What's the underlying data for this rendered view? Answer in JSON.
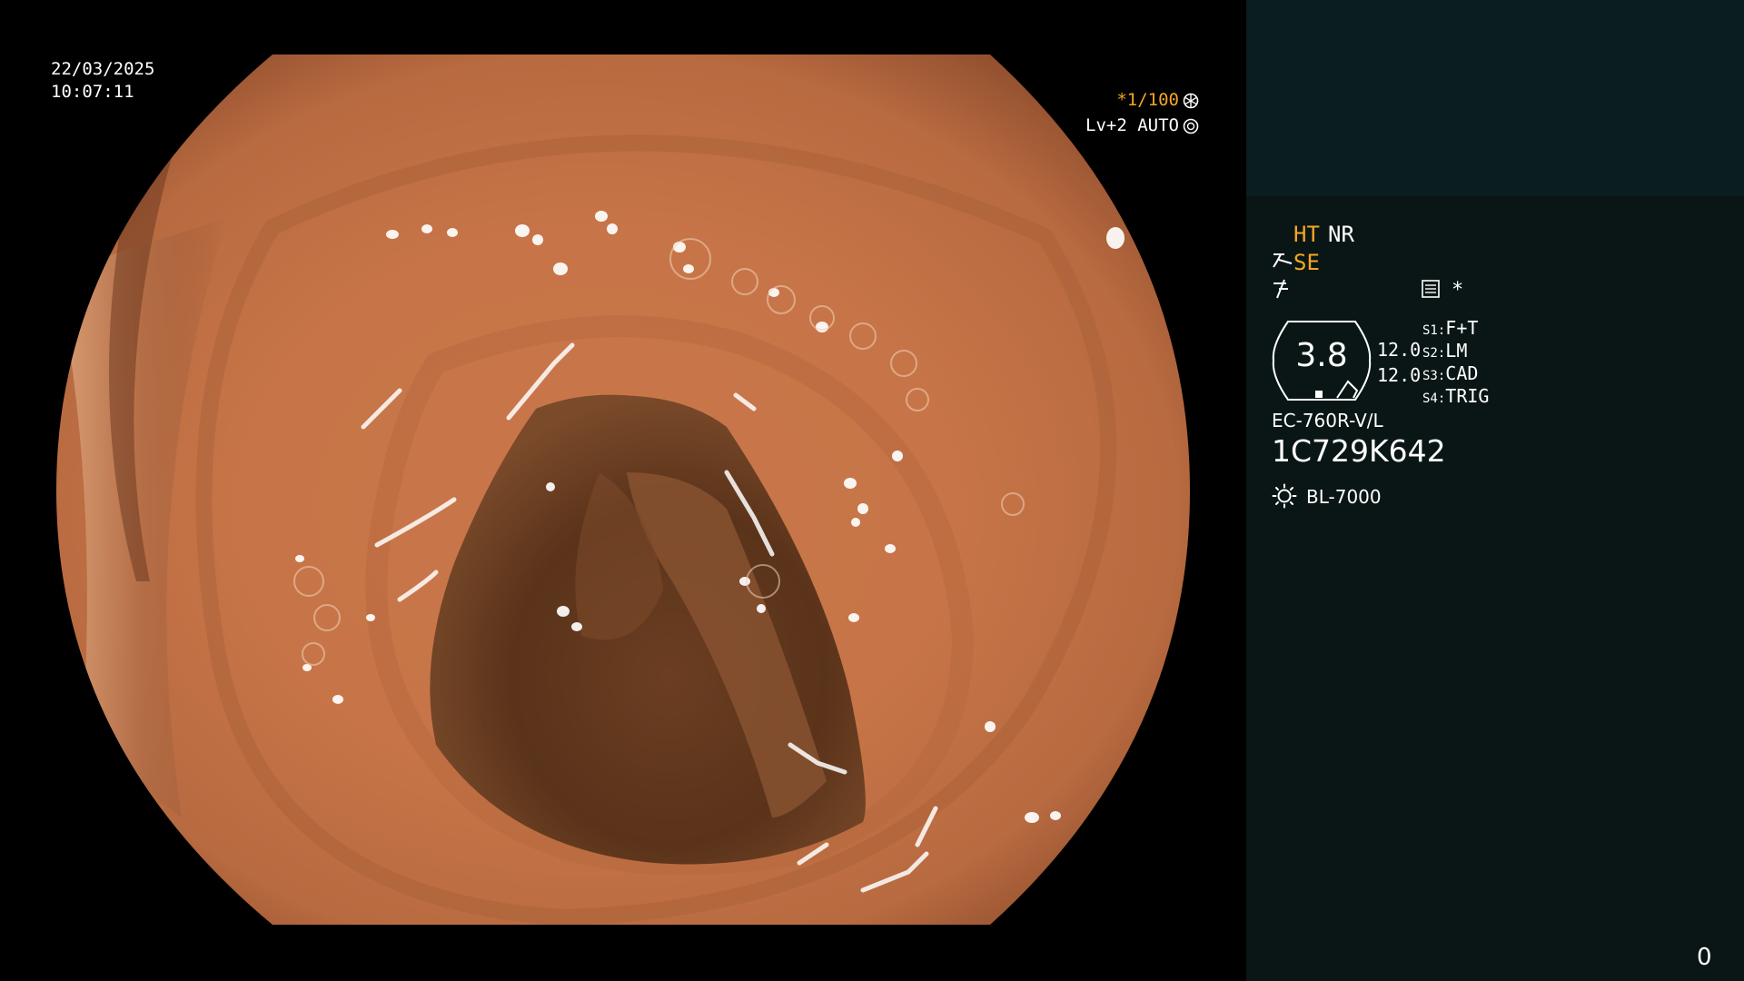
{
  "overlay": {
    "date": "22/03/2025",
    "time": "10:07:11",
    "shutter": "*1/100",
    "exposure": "Lv+2 AUTO"
  },
  "panel": {
    "ht": "HT",
    "nr": "NR",
    "se": "SE",
    "asterisk": "*",
    "gauge_value": "3.8",
    "value_1": "12.0",
    "value_2": "12.0",
    "switches": [
      {
        "key": "S1:",
        "value": "F+T"
      },
      {
        "key": "S2:",
        "value": "LM"
      },
      {
        "key": "S3:",
        "value": "CAD"
      },
      {
        "key": "S4:",
        "value": "TRIG"
      }
    ],
    "scope_model": "EC-760R-V/L",
    "scope_serial": "1C729K642",
    "light_source": "BL-7000",
    "counter": "0"
  },
  "colors": {
    "accent": "#f5a623",
    "panel_bg": "#0a1616",
    "panel_header_bg": "#0b1e1f"
  },
  "icons": [
    "shutter-wheel-icon",
    "auto-iris-icon",
    "se-scope-icon",
    "bolt-icon",
    "menu-icon",
    "gauge-icon",
    "sun-icon"
  ]
}
